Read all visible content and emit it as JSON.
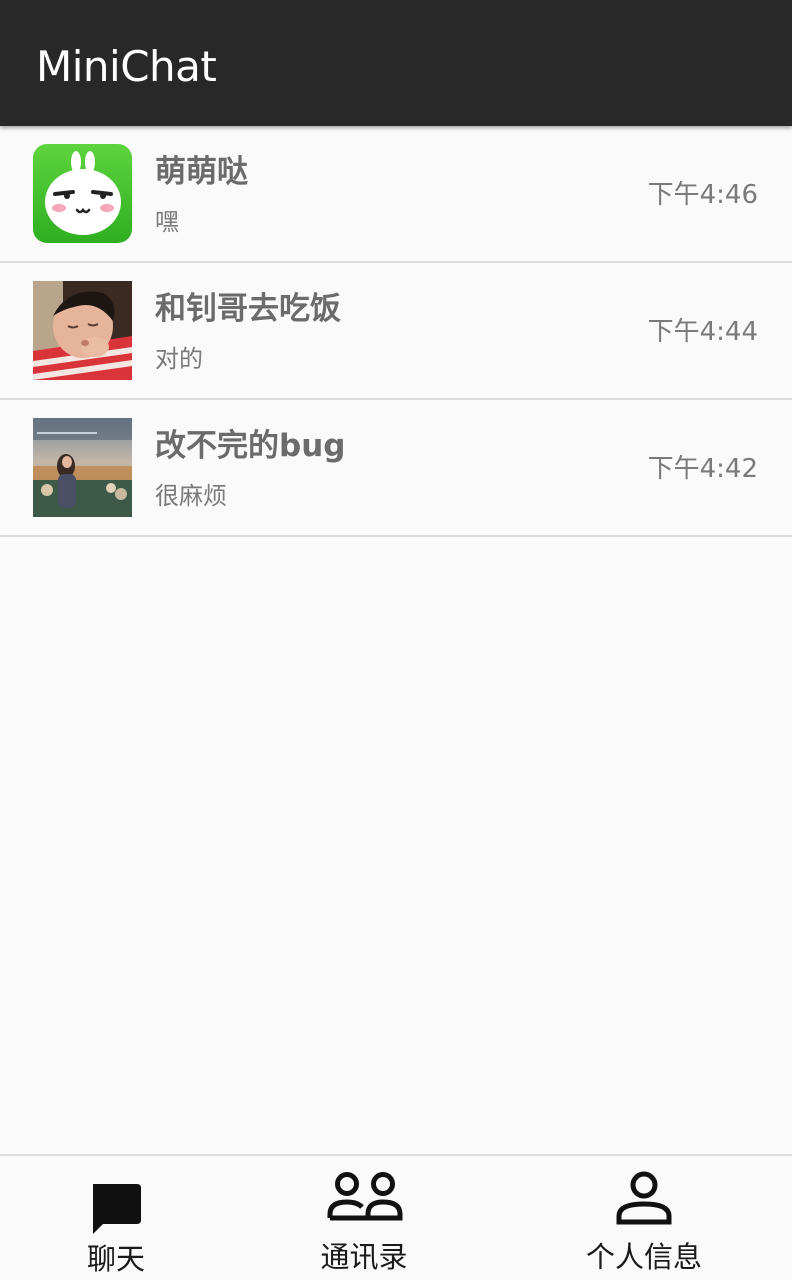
{
  "app": {
    "title": "MiniChat"
  },
  "chats": [
    {
      "name": "萌萌哒",
      "preview": "嘿",
      "time": "下午4:46",
      "avatar": "bunny-sticker-avatar"
    },
    {
      "name": "和钊哥去吃饭",
      "preview": "对的",
      "time": "下午4:44",
      "avatar": "sleeping-child-photo-avatar"
    },
    {
      "name": "改不完的bug",
      "preview": "很麻烦",
      "time": "下午4:42",
      "avatar": "outdoor-girl-photo-avatar"
    }
  ],
  "nav": {
    "chat_label": "聊天",
    "contacts_label": "通讯录",
    "profile_label": "个人信息"
  },
  "colors": {
    "app_bar": "#282828",
    "background": "#fafafa",
    "bunny_green": "#3cb82c",
    "divider": "#dcdcdc"
  }
}
